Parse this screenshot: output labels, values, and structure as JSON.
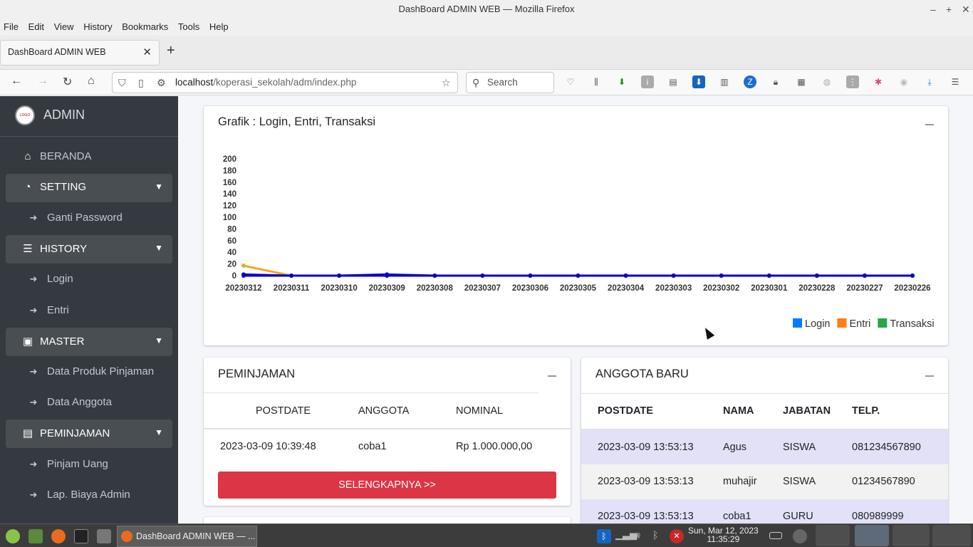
{
  "window": {
    "title": "DashBoard ADMIN WEB — Mozilla Firefox"
  },
  "menu": [
    "File",
    "Edit",
    "View",
    "History",
    "Bookmarks",
    "Tools",
    "Help"
  ],
  "tab": {
    "label": "DashBoard ADMIN WEB"
  },
  "url": {
    "host": "localhost",
    "path": "/koperasi_sekolah/adm/index.php"
  },
  "search": {
    "placeholder": "Search"
  },
  "sidebar": {
    "brand": "ADMIN",
    "logo_text": "LOGO",
    "items": [
      {
        "label": "BERANDA",
        "icon": "home-icon"
      },
      {
        "label": "SETTING",
        "icon": "dashboard-icon"
      },
      {
        "label": "Ganti Password",
        "icon": "arrow-circle-icon"
      },
      {
        "label": "HISTORY",
        "icon": "list-icon"
      },
      {
        "label": "Login",
        "icon": "arrow-circle-icon"
      },
      {
        "label": "Entri",
        "icon": "arrow-circle-icon"
      },
      {
        "label": "MASTER",
        "icon": "briefcase-icon"
      },
      {
        "label": "Data Produk Pinjaman",
        "icon": "arrow-circle-icon"
      },
      {
        "label": "Data Anggota",
        "icon": "arrow-circle-icon"
      },
      {
        "label": "PEMINJAMAN",
        "icon": "money-icon"
      },
      {
        "label": "Pinjam Uang",
        "icon": "arrow-circle-icon"
      },
      {
        "label": "Lap. Biaya Admin",
        "icon": "arrow-circle-icon"
      }
    ]
  },
  "chart_card": {
    "title": "Grafik : Login, Entri, Transaksi"
  },
  "chart_data": {
    "type": "line",
    "categories": [
      "20230312",
      "20230311",
      "20230310",
      "20230309",
      "20230308",
      "20230307",
      "20230306",
      "20230305",
      "20230304",
      "20230303",
      "20230302",
      "20230301",
      "20230228",
      "20230227",
      "20230226"
    ],
    "ylim": [
      0,
      200
    ],
    "yticks": [
      0,
      20,
      40,
      60,
      80,
      100,
      120,
      140,
      160,
      180,
      200
    ],
    "series": [
      {
        "name": "Login",
        "color": "#007bff",
        "values": [
          2,
          0,
          0,
          2,
          0,
          0,
          0,
          0,
          0,
          0,
          0,
          0,
          0,
          0,
          0
        ]
      },
      {
        "name": "Entri",
        "color": "#fd7e14",
        "values": [
          17,
          0,
          0,
          1,
          0,
          0,
          0,
          0,
          0,
          0,
          0,
          0,
          0,
          0,
          0
        ]
      },
      {
        "name": "Transaksi",
        "color": "#28a745",
        "values": [
          0,
          0,
          0,
          0,
          0,
          0,
          0,
          0,
          0,
          0,
          0,
          0,
          0,
          0,
          0
        ]
      }
    ],
    "line_color": "#0000cc",
    "legend_position": "bottom-right",
    "grid": false
  },
  "peminjaman": {
    "title": "PEMINJAMAN",
    "headers": [
      "POSTDATE",
      "ANGGOTA",
      "NOMINAL"
    ],
    "rows": [
      [
        "2023-03-09 10:39:48",
        "coba1",
        "Rp 1.000.000,00"
      ]
    ],
    "more_label": "SELENGKAPNYA >>"
  },
  "anggota": {
    "title": "ANGGOTA BARU",
    "headers": [
      "POSTDATE",
      "NAMA",
      "JABATAN",
      "TELP."
    ],
    "rows": [
      [
        "2023-03-09 13:53:13",
        "Agus",
        "SISWA",
        "081234567890"
      ],
      [
        "2023-03-09 13:53:13",
        "muhajir",
        "SISWA",
        "01234567890"
      ],
      [
        "2023-03-09 13:53:13",
        "coba1",
        "GURU",
        "080989999"
      ]
    ]
  },
  "taskbar": {
    "window_label": "DashBoard ADMIN WEB — ...",
    "date": "Sun, Mar 12, 2023",
    "time": "11:35:29"
  }
}
